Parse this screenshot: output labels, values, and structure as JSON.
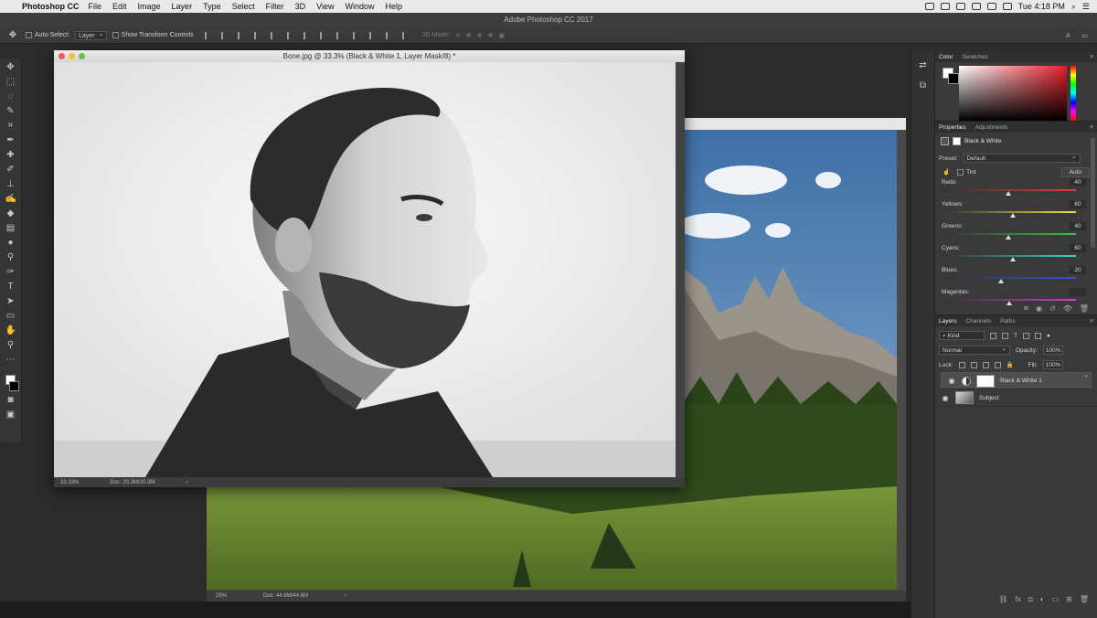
{
  "menubar": {
    "apple": "",
    "app_name": "Photoshop CC",
    "items": [
      "File",
      "Edit",
      "Image",
      "Layer",
      "Type",
      "Select",
      "Filter",
      "3D",
      "View",
      "Window",
      "Help"
    ],
    "window_title": "Adobe Photoshop CC 2017",
    "clock": "Tue 4:18 PM"
  },
  "options": {
    "auto_select_label": "Auto-Select:",
    "auto_select_value": "Layer",
    "transform_label": "Show Transform Controls",
    "mode_3d_label": "3D Mode:"
  },
  "doc1": {
    "title": "Bone.jpg @ 33.3% (Black & White 1, Layer Mask/8) *",
    "zoom": "33.33%",
    "doc_size": "Doc: 20.3M/20.3M"
  },
  "doc2": {
    "zoom": "25%",
    "doc_size": "Doc: 44.6M/44.6M"
  },
  "color_panel": {
    "tabs": [
      "Color",
      "Swatches"
    ],
    "fg_color": "#ffffff",
    "bg_color": "#000000"
  },
  "properties_panel": {
    "tabs": [
      "Properties",
      "Adjustments"
    ],
    "header": "Black & White",
    "preset_label": "Preset:",
    "preset_value": "Default",
    "tint_label": "Tint",
    "auto_label": "Auto",
    "sliders": [
      {
        "label": "Reds:",
        "value": "40",
        "fraction": 0.49,
        "gradient": "linear-gradient(to right,#333,#e23b3b)"
      },
      {
        "label": "Yellows:",
        "value": "60",
        "fraction": 0.53,
        "gradient": "linear-gradient(to right,#333,#e6e23a)"
      },
      {
        "label": "Greens:",
        "value": "40",
        "fraction": 0.49,
        "gradient": "linear-gradient(to right,#333,#3fc03f)"
      },
      {
        "label": "Cyans:",
        "value": "60",
        "fraction": 0.53,
        "gradient": "linear-gradient(to right,#333,#3ad0d0)"
      },
      {
        "label": "Blues:",
        "value": "20",
        "fraction": 0.44,
        "gradient": "linear-gradient(to right,#333,#3a4ee0)"
      },
      {
        "label": "Magentas:",
        "value": "",
        "fraction": 0.5,
        "gradient": "linear-gradient(to right,#333,#d03ad0)"
      }
    ]
  },
  "layers_panel": {
    "tabs": [
      "Layers",
      "Channels",
      "Paths"
    ],
    "kind_label": "Kind",
    "blend_mode": "Normal",
    "opacity_label": "Opacity:",
    "opacity_value": "100%",
    "lock_label": "Lock:",
    "fill_label": "Fill:",
    "fill_value": "100%",
    "layers": [
      {
        "name": "Black & White 1",
        "selected": true
      },
      {
        "name": "Subject",
        "selected": false
      }
    ]
  }
}
